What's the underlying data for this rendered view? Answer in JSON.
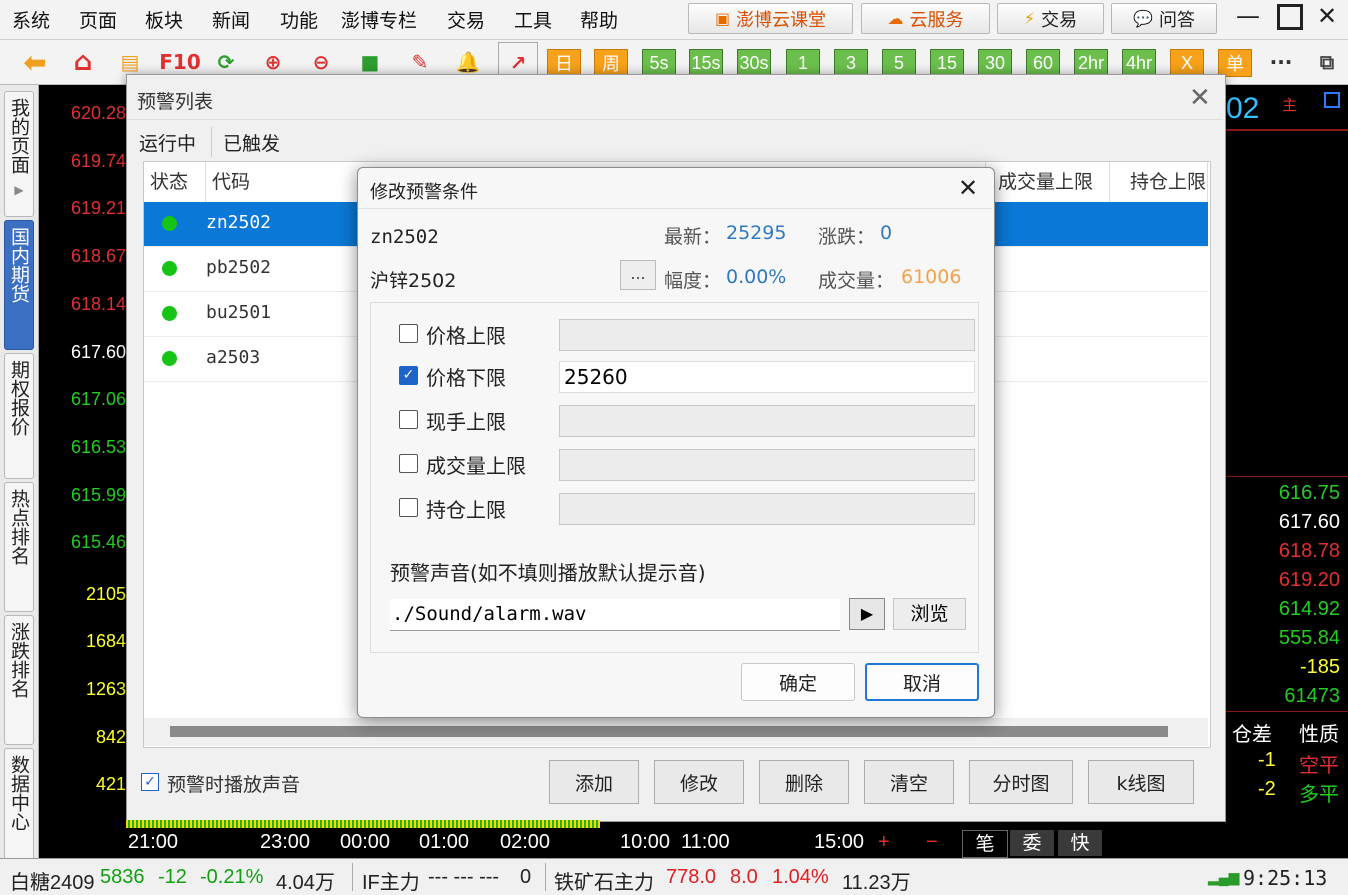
{
  "menu": [
    "系统",
    "页面",
    "板块",
    "新闻",
    "功能",
    "澎博专栏",
    "交易",
    "工具",
    "帮助"
  ],
  "services": [
    {
      "label": "澎博云课堂",
      "icon": "classroom-icon",
      "color": "#e56b00"
    },
    {
      "label": "云服务",
      "icon": "cloud-icon",
      "color": "#e56b00"
    },
    {
      "label": "交易",
      "icon": "lightning-icon",
      "color": "#e5a000"
    },
    {
      "label": "问答",
      "icon": "chat-bubble-icon",
      "color": "#555555"
    }
  ],
  "toolbar": {
    "f10": "F10",
    "periods": [
      "日",
      "周",
      "5s",
      "15s",
      "30s",
      "1",
      "3",
      "5",
      "15",
      "30",
      "60",
      "2hr",
      "4hr",
      "X",
      "单"
    ],
    "more": "···"
  },
  "left_tabs": [
    "我的页面",
    "国内期货",
    "期权报价",
    "热点排名",
    "涨跌排名",
    "数据中心"
  ],
  "left_axis": {
    "prices": [
      {
        "v": "620.28",
        "c": "#e03030"
      },
      {
        "v": "619.74",
        "c": "#e03030"
      },
      {
        "v": "619.21",
        "c": "#e03030"
      },
      {
        "v": "618.67",
        "c": "#e03030"
      },
      {
        "v": "618.14",
        "c": "#e03030"
      },
      {
        "v": "617.60",
        "c": "#ffffff"
      },
      {
        "v": "617.06",
        "c": "#22cc22"
      },
      {
        "v": "616.53",
        "c": "#22cc22"
      },
      {
        "v": "615.99",
        "c": "#22cc22"
      },
      {
        "v": "615.46",
        "c": "#22cc22"
      }
    ],
    "volumes": [
      "2105",
      "1684",
      "1263",
      "842",
      "421"
    ]
  },
  "right_panel": {
    "header_partial": "02",
    "header_tag": "主",
    "quotes": [
      {
        "v": "616.75",
        "c": "#22cc22"
      },
      {
        "v": "617.60",
        "c": "#ffffff"
      },
      {
        "v": "618.78",
        "c": "#e03030"
      },
      {
        "v": "619.20",
        "c": "#e03030"
      },
      {
        "v": "614.92",
        "c": "#22cc22"
      },
      {
        "v": "555.84",
        "c": "#22cc22"
      },
      {
        "v": "-185",
        "c": "#ffff33"
      },
      {
        "v": "61473",
        "c": "#22cc22"
      }
    ],
    "col_headers": [
      "仓差",
      "性质"
    ],
    "rows": [
      {
        "diff": "-1",
        "nature": "空平",
        "nature_color": "#e03030"
      },
      {
        "diff": "-2",
        "nature": "多平",
        "nature_color": "#22cc22"
      }
    ]
  },
  "alert_window": {
    "title": "预警列表",
    "tabs": [
      "运行中",
      "已触发"
    ],
    "columns": [
      "状态",
      "代码",
      "成交量上限",
      "持仓上限"
    ],
    "rows": [
      {
        "code": "zn2502",
        "selected": true
      },
      {
        "code": "pb2502",
        "selected": false
      },
      {
        "code": "bu2501",
        "selected": false
      },
      {
        "code": "a2503",
        "selected": false
      }
    ],
    "play_sound_label": "预警时播放声音",
    "play_sound_checked": true,
    "buttons": [
      "添加",
      "修改",
      "删除",
      "清空",
      "分时图",
      "k线图"
    ]
  },
  "dialog": {
    "title": "修改预警条件",
    "symbol": "zn2502",
    "name": "沪锌2502",
    "ellipsis": "...",
    "latest_label": "最新：",
    "latest_value": "25295",
    "change_label": "涨跌：",
    "change_value": "0",
    "range_label": "幅度：",
    "range_value": "0.00%",
    "volume_label": "成交量：",
    "volume_value": "61006",
    "conditions": [
      {
        "label": "价格上限",
        "checked": false,
        "value": ""
      },
      {
        "label": "价格下限",
        "checked": true,
        "value": "25260"
      },
      {
        "label": "现手上限",
        "checked": false,
        "value": ""
      },
      {
        "label": "成交量上限",
        "checked": false,
        "value": ""
      },
      {
        "label": "持仓上限",
        "checked": false,
        "value": ""
      }
    ],
    "sound_label": "预警声音(如不填则播放默认提示音)",
    "sound_path": "./Sound/alarm.wav",
    "browse_label": "浏览",
    "ok_label": "确定",
    "cancel_label": "取消"
  },
  "time_axis": [
    "21:00",
    "23:00",
    "00:00",
    "01:00",
    "02:00",
    "10:00",
    "11:00",
    "15:00"
  ],
  "trade_tabs": [
    "笔",
    "委",
    "快"
  ],
  "status_bar": {
    "sugar_name": "白糖2409",
    "sugar_price": "5836",
    "sugar_change": "-12",
    "sugar_pct": "-0.21%",
    "sugar_vol": "4.04万",
    "if_name": "IF主力",
    "if_values": "---  ---  ---",
    "if_zero": "0",
    "ore_name": "铁矿石主力",
    "ore_price": "778.0",
    "ore_change": "8.0",
    "ore_pct": "1.04%",
    "ore_vol": "11.23万",
    "clock": "9:25:13"
  }
}
